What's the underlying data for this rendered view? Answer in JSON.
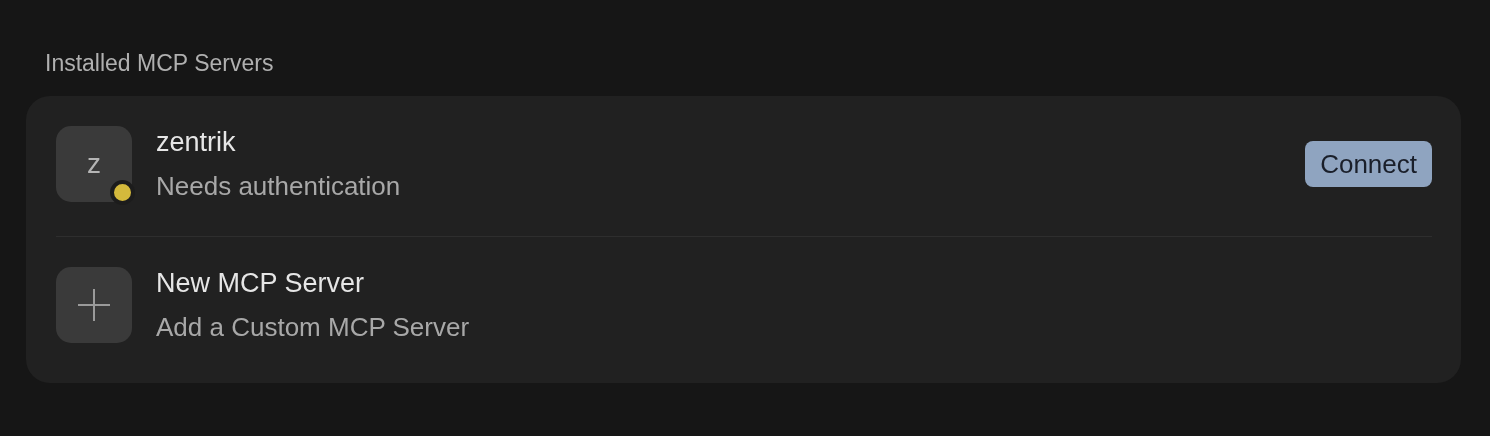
{
  "section_title": "Installed MCP Servers",
  "items": [
    {
      "kind": "server",
      "initial": "z",
      "name": "zentrik",
      "subtitle": "Needs authentication",
      "color": "#d4b93c",
      "action": "Connect"
    },
    {
      "kind": "add",
      "name": "New MCP Server",
      "subtitle": "Add a Custom MCP Server"
    }
  ]
}
